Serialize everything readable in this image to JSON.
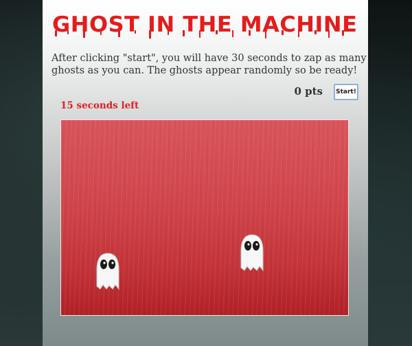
{
  "title": "GHOST IN THE MACHINE",
  "instructions": "After clicking \"start\", you will have 30 seconds to zap as many ghosts as you can. The ghosts appear randomly so be ready!",
  "score": {
    "value": 0,
    "unit": "pts",
    "text": "0 pts"
  },
  "start_button": "Start!",
  "timer": {
    "seconds": 15,
    "text": "15 seconds left"
  },
  "colors": {
    "accent": "#e41c1c",
    "timer": "#e02020",
    "field": "#c33338"
  },
  "ghosts": [
    {
      "icon": "ghost-icon"
    },
    {
      "icon": "ghost-icon"
    }
  ]
}
